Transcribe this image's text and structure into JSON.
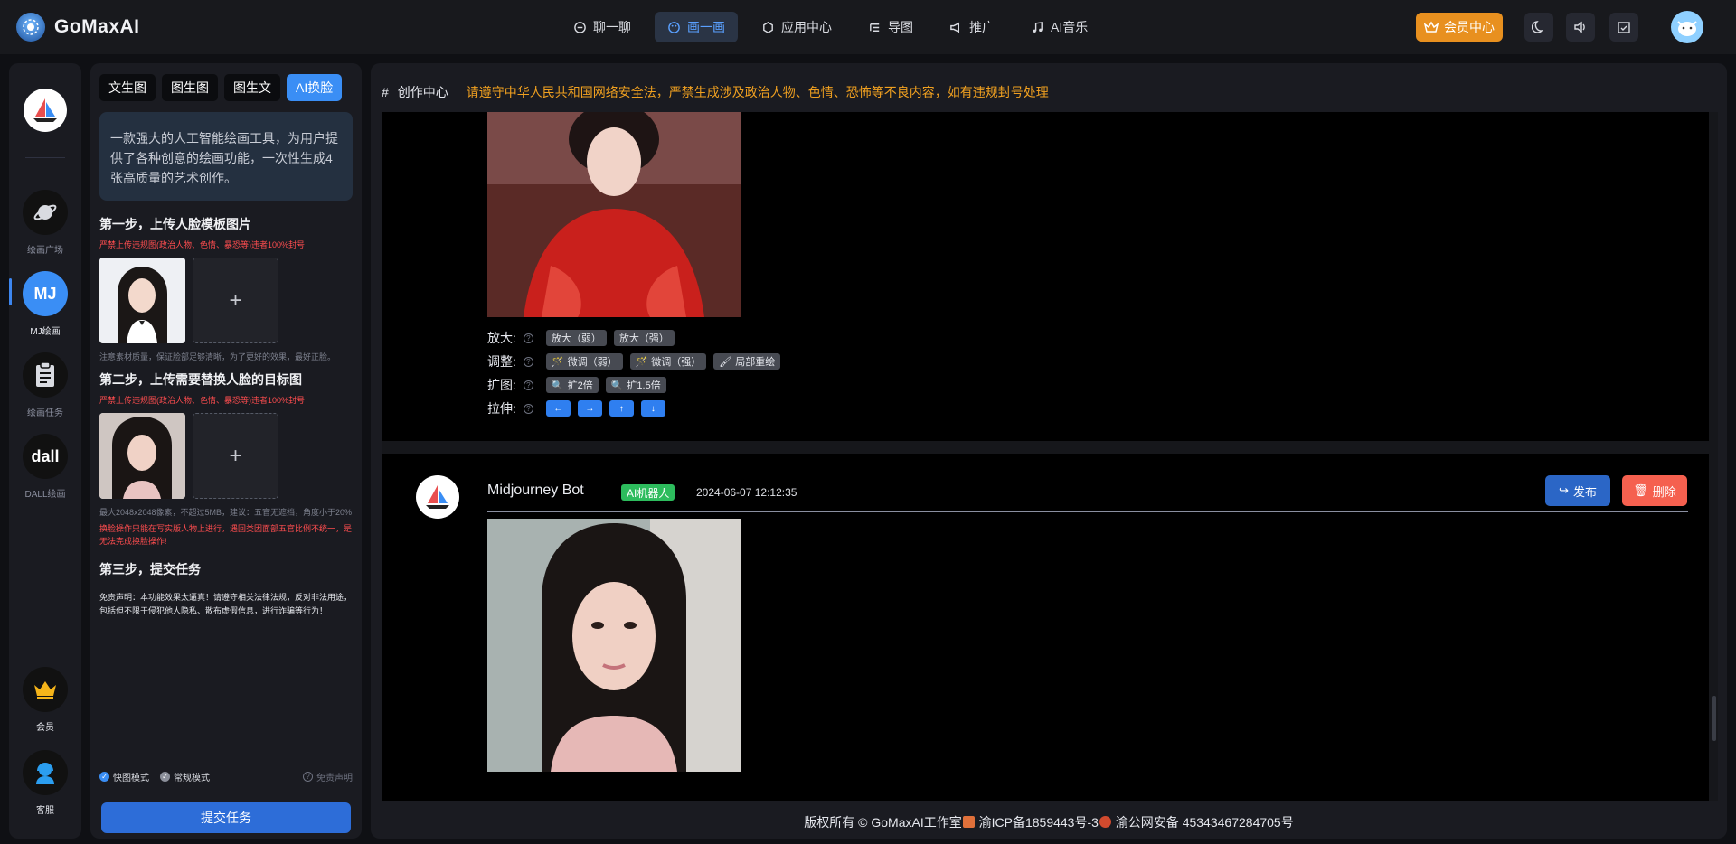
{
  "app": {
    "name": "GoMaxAI"
  },
  "nav": {
    "items": [
      {
        "label": "聊一聊",
        "icon": "chat-icon",
        "active": false
      },
      {
        "label": "画一画",
        "icon": "palette-icon",
        "active": true
      },
      {
        "label": "应用中心",
        "icon": "cube-icon",
        "active": false
      },
      {
        "label": "导图",
        "icon": "mindmap-icon",
        "active": false
      },
      {
        "label": "推广",
        "icon": "megaphone-icon",
        "active": false
      },
      {
        "label": "AI音乐",
        "icon": "music-icon",
        "active": false
      }
    ],
    "vip_label": "会员中心"
  },
  "rail": {
    "items": [
      {
        "label": "绘画广场",
        "icon": "planet-icon"
      },
      {
        "label": "MJ绘画",
        "icon": "mj-icon",
        "badge": "MJ"
      },
      {
        "label": "绘画任务",
        "icon": "clipboard-icon"
      },
      {
        "label": "DALL绘画",
        "icon": "dall-icon",
        "badge": "dall"
      },
      {
        "label": "会员",
        "icon": "crown-icon"
      },
      {
        "label": "客服",
        "icon": "support-agent-icon"
      }
    ]
  },
  "panel": {
    "tabs": [
      "文生图",
      "图生图",
      "图生文",
      "AI换脸"
    ],
    "active_tab": "AI换脸",
    "intro": "一款强大的人工智能绘画工具，为用户提供了各种创意的绘画功能，一次性生成4张高质量的艺术创作。",
    "step1_title": "第一步，上传人脸模板图片",
    "step1_warn": "严禁上传违规图(政治人物、色情、暴恐等)违者100%封号",
    "step1_note": "注意素材质量，保证脸部足够清晰，为了更好的效果，最好正脸。",
    "step2_title": "第二步，上传需要替换人脸的目标图",
    "step2_warn": "严禁上传违规图(政治人物、色情、暴恐等)违者100%封号",
    "step2_note": "最大2048x2048像素，不超过5MB，建议：五官无遮挡，角度小于20%",
    "step2_warn2": "换脸操作只能在写实版人物上进行，遇回类因面部五官比例不统一，是无法完成换脸操作!",
    "step3_title": "第三步，提交任务",
    "disclaimer": "免责声明：本功能效果太逼真！请遵守相关法律法规，反对非法用途，包括但不限于侵犯他人隐私、散布虚假信息，进行诈骗等行为！",
    "mode_fast": "快图模式",
    "mode_normal": "常规模式",
    "mode_disclaimer": "免责声明",
    "submit_label": "提交任务",
    "plus": "+"
  },
  "main": {
    "hash": "#",
    "title": "创作中心",
    "notice": "请遵守中华人民共和国网络安全法，严禁生成涉及政治人物、色情、恐怖等不良内容，如有违规封号处理",
    "controls": {
      "upscale_label": "放大:",
      "upscale": [
        "放大（弱）",
        "放大（强）"
      ],
      "adjust_label": "调整:",
      "adjust": [
        "微调（弱）",
        "微调（强）",
        "局部重绘"
      ],
      "expand_label": "扩图:",
      "expand": [
        "扩2倍",
        "扩1.5倍"
      ],
      "stretch_label": "拉伸:",
      "stretch": [
        "←",
        "→",
        "↑",
        "↓"
      ]
    },
    "message": {
      "bot_name": "Midjourney Bot",
      "badge": "AI机器人",
      "time": "2024-06-07 12:12:35",
      "publish": "发布",
      "delete": "删除"
    }
  },
  "footer": {
    "copyright": "版权所有 © GoMaxAI工作室",
    "icp": "渝ICP备1859443号-3",
    "police": "渝公网安备 45343467284705号"
  },
  "colors": {
    "accent": "#3a8ef5",
    "vip": "#e8901f",
    "notice": "#f0a020",
    "danger": "#f5604f",
    "success": "#2dbc5d"
  }
}
